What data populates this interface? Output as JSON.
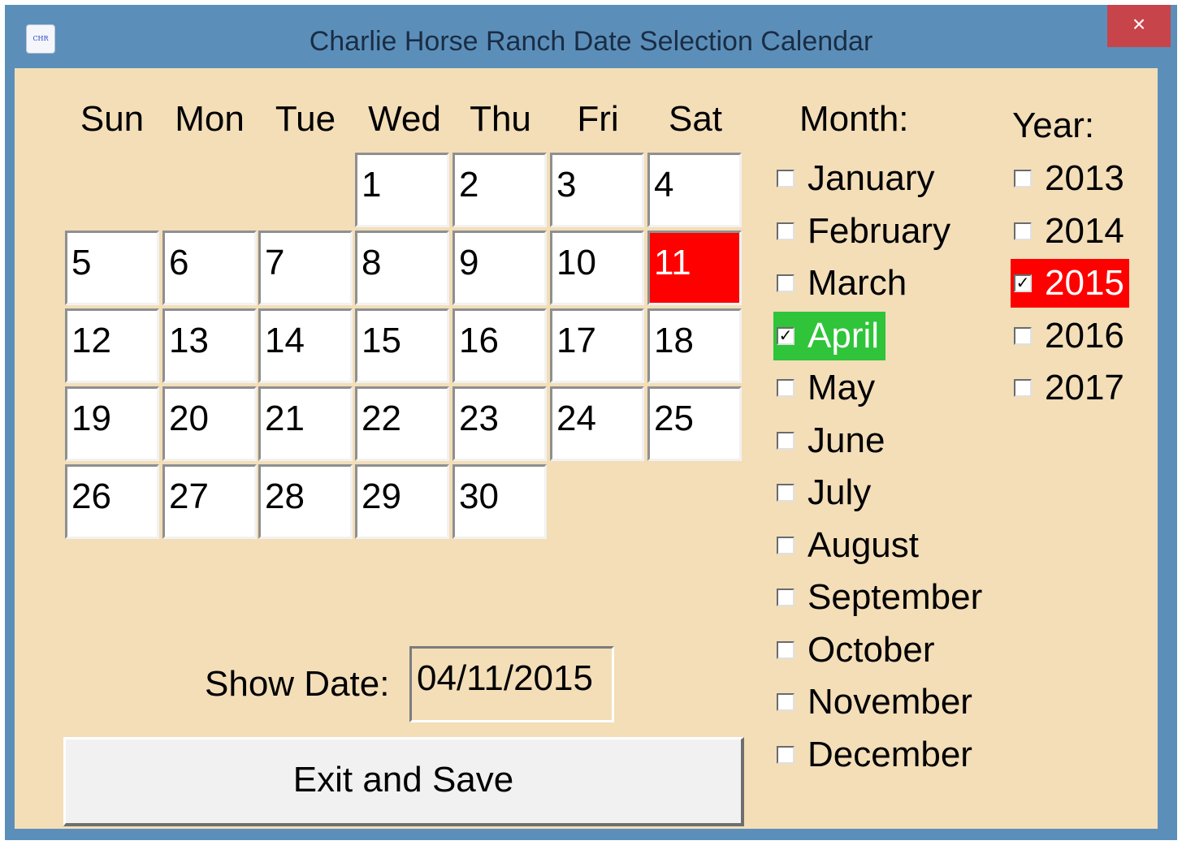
{
  "window": {
    "title": "Charlie Horse Ranch Date Selection Calendar",
    "icon_text": "CHR",
    "close_glyph": "×"
  },
  "calendar": {
    "weekdays": [
      "Sun",
      "Mon",
      "Tue",
      "Wed",
      "Thu",
      "Fri",
      "Sat"
    ],
    "first_weekday_index": 3,
    "days": [
      "1",
      "2",
      "3",
      "4",
      "5",
      "6",
      "7",
      "8",
      "9",
      "10",
      "11",
      "12",
      "13",
      "14",
      "15",
      "16",
      "17",
      "18",
      "19",
      "20",
      "21",
      "22",
      "23",
      "24",
      "25",
      "26",
      "27",
      "28",
      "29",
      "30"
    ],
    "selected_day": "11"
  },
  "month_panel": {
    "label": "Month:",
    "months": [
      "January",
      "February",
      "March",
      "April",
      "May",
      "June",
      "July",
      "August",
      "September",
      "October",
      "November",
      "December"
    ],
    "selected": "April"
  },
  "year_panel": {
    "label": "Year:",
    "years": [
      "2013",
      "2014",
      "2015",
      "2016",
      "2017"
    ],
    "selected": "2015"
  },
  "show_date": {
    "label": "Show Date:",
    "value": "04/11/2015"
  },
  "exit_button": {
    "label": "Exit and Save"
  },
  "colors": {
    "background": "#f3deb8",
    "selected_day": "#ff0000",
    "selected_month": "#2fc43a",
    "selected_year": "#ff0000",
    "title_bar": "#5b8fba"
  }
}
